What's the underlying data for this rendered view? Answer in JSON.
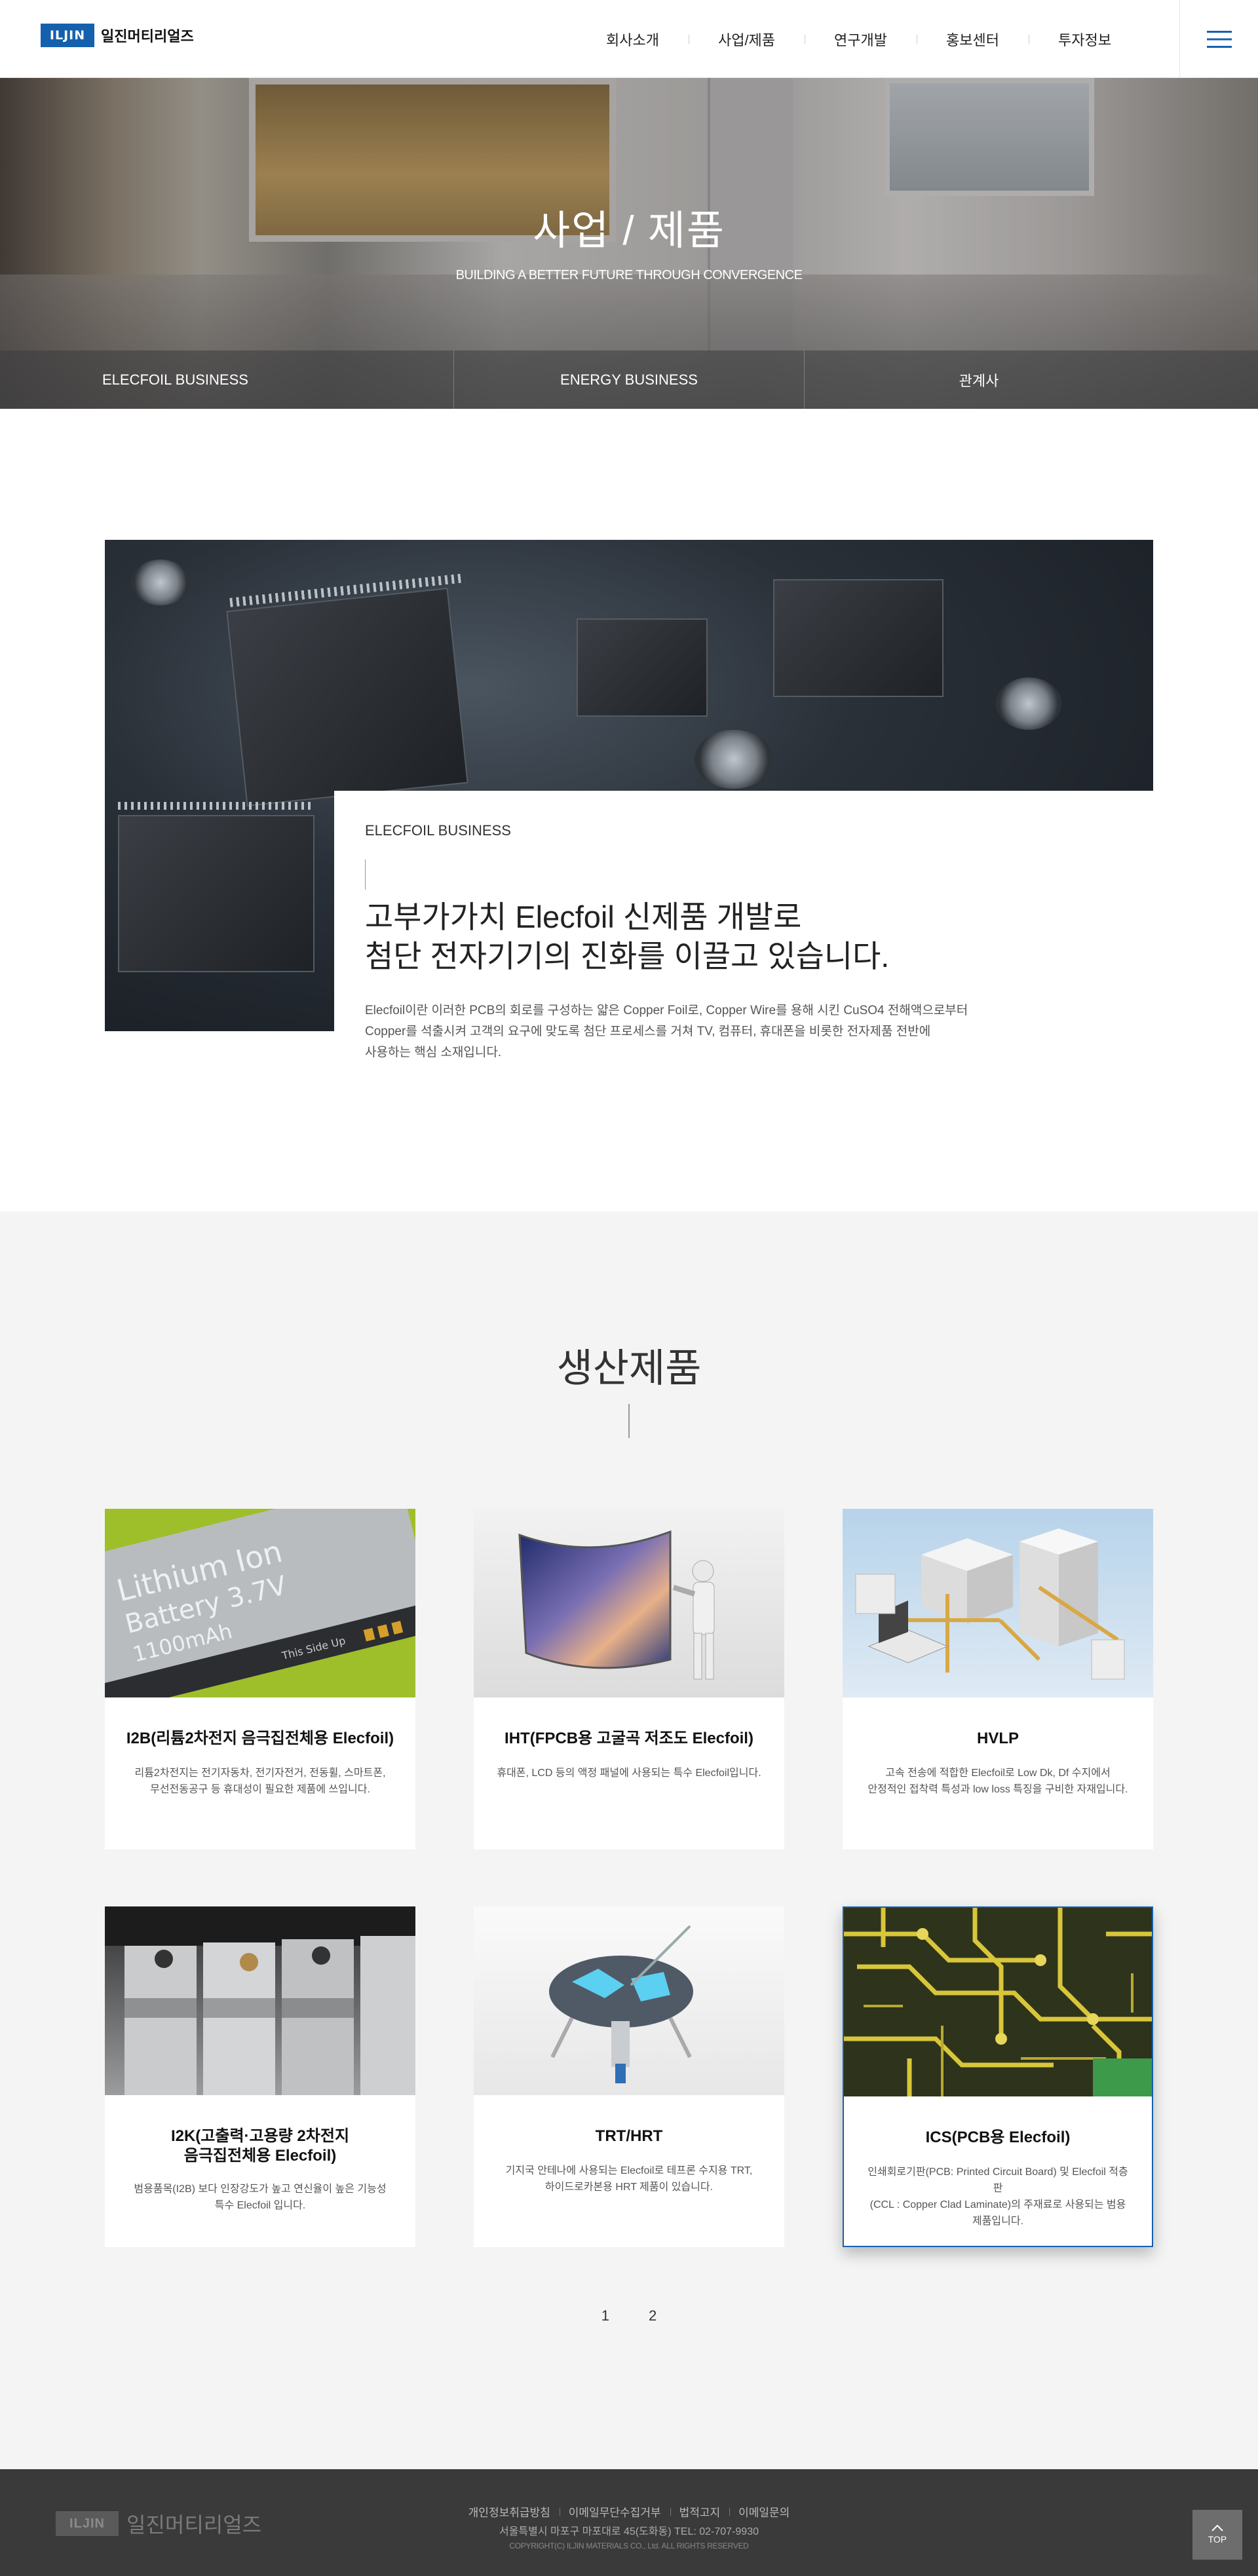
{
  "header": {
    "logo_mark": "ILJIN",
    "logo_text": "일진머티리얼즈",
    "nav": [
      "회사소개",
      "사업/제품",
      "연구개발",
      "홍보센터",
      "투자정보"
    ]
  },
  "hero": {
    "title": "사업 / 제품",
    "subtitle": "BUILDING A BETTER FUTURE THROUGH CONVERGENCE",
    "tabs": [
      "ELECFOIL BUSINESS",
      "ENERGY BUSINESS",
      "관계사"
    ]
  },
  "intro": {
    "label": "ELECFOIL BUSINESS",
    "headline_1": "고부가가치 Elecfoil 신제품 개발로",
    "headline_2": "첨단 전자기기의 진화를 이끌고 있습니다.",
    "desc_1": "Elecfoil이란 이러한 PCB의 회로를 구성하는 얇은 Copper Foil로, Copper Wire를 용해 시킨 CuSO4 전해액으로부터",
    "desc_2": "Copper를 석출시켜 고객의 요구에 맞도록 첨단 프로세스를 거쳐 TV, 컴퓨터, 휴대폰을 비롯한 전자제품 전반에",
    "desc_3": "사용하는 핵심 소재입니다."
  },
  "products": {
    "title": "생산제품",
    "items": [
      {
        "title": "I2B(리튬2차전지 음극집전체용 Elecfoil)",
        "desc": [
          "리튬2차전지는 전기자동차, 전기자전거, 전동휠, 스마트폰,",
          "무선전동공구 등 휴대성이 필요한 제품에 쓰입니다."
        ]
      },
      {
        "title": "IHT(FPCB용 고굴곡 저조도 Elecfoil)",
        "desc": [
          "휴대폰, LCD 등의 액정 패널에 사용되는 특수 Elecfoil입니다."
        ]
      },
      {
        "title": "HVLP",
        "desc": [
          "고속 전송에 적합한 Elecfoil로 Low Dk, Df 수지에서",
          "안정적인 접착력 특성과 low loss 특징을 구비한 자재입니다."
        ]
      },
      {
        "title_1": "I2K(고출력·고용량 2차전지",
        "title_2": "음극집전체용 Elecfoil)",
        "desc": [
          "범용품목(I2B) 보다 인장강도가 높고 연신율이 높은 기능성",
          "특수 Elecfoil 입니다."
        ]
      },
      {
        "title": "TRT/HRT",
        "desc": [
          "기지국 안테나에 사용되는 Elecfoil로 테프론 수지용 TRT,",
          "하이드로카본용 HRT 제품이 있습니다."
        ]
      },
      {
        "title": "ICS(PCB용 Elecfoil)",
        "desc": [
          "인쇄회로기판(PCB: Printed Circuit Board) 및 Elecfoil 적층판",
          "(CCL : Copper Clad Laminate)의 주재료로 사용되는 범용",
          "제품입니다."
        ]
      }
    ],
    "battery_text_1": "Lithium Ion",
    "battery_text_2": "Battery 3.7V",
    "battery_text_3": "1100mAh",
    "battery_text_4": "This Side Up",
    "pages": [
      "1",
      "2"
    ]
  },
  "footer": {
    "logo_mark": "ILJIN",
    "logo_text": "일진머티리얼즈",
    "links": [
      "개인정보취급방침",
      "이메일무단수집거부",
      "법적고지",
      "이메일문의"
    ],
    "address": "서울특별시 마포구 마포대로 45(도화동) TEL: 02-707-9930",
    "copyright": "COPYRIGHT(C) ILJIN MATERIALS CO., Ltd. ALL RIGHTS RESERVED",
    "top_label": "TOP"
  },
  "colors": {
    "brand": "#1560ad",
    "footer_bg": "#3a3a3a",
    "section_bg": "#f4f4f4"
  }
}
